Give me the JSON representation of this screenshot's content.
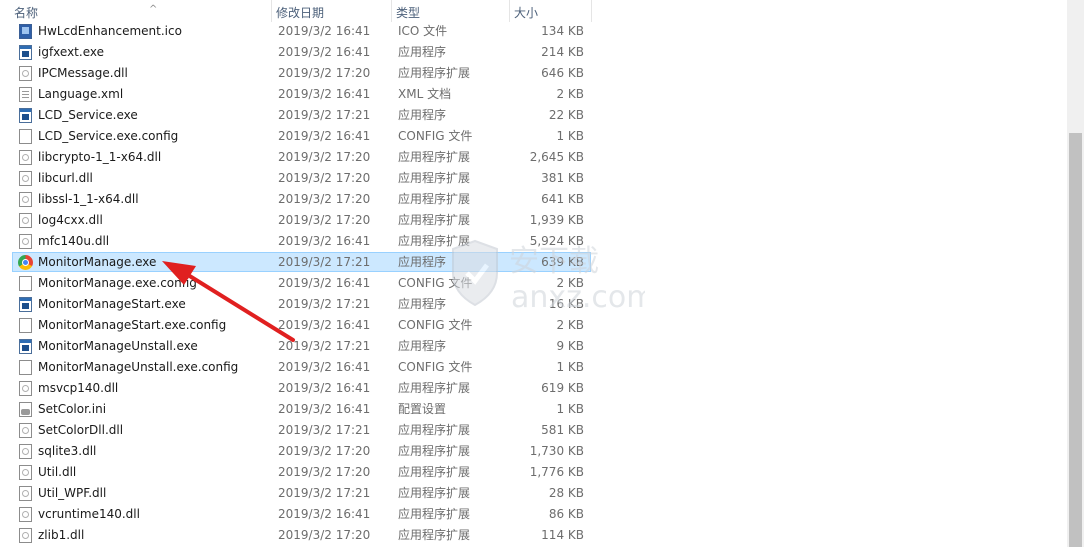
{
  "columns": {
    "name": "名称",
    "date": "修改日期",
    "type": "类型",
    "size": "大小"
  },
  "sort_indicator": "^",
  "files": [
    {
      "icon": "ico-file-icon",
      "name": "HwLcdEnhancement.ico",
      "date": "2019/3/2 16:41",
      "type": "ICO 文件",
      "size": "134 KB"
    },
    {
      "icon": "exe-file-icon",
      "name": "igfxext.exe",
      "date": "2019/3/2 16:41",
      "type": "应用程序",
      "size": "214 KB"
    },
    {
      "icon": "dll-file-icon",
      "name": "IPCMessage.dll",
      "date": "2019/3/2 17:20",
      "type": "应用程序扩展",
      "size": "646 KB"
    },
    {
      "icon": "xml-file-icon",
      "name": "Language.xml",
      "date": "2019/3/2 16:41",
      "type": "XML 文档",
      "size": "2 KB"
    },
    {
      "icon": "exe-file-icon",
      "name": "LCD_Service.exe",
      "date": "2019/3/2 17:21",
      "type": "应用程序",
      "size": "22 KB"
    },
    {
      "icon": "config-file-icon",
      "name": "LCD_Service.exe.config",
      "date": "2019/3/2 16:41",
      "type": "CONFIG 文件",
      "size": "1 KB"
    },
    {
      "icon": "dll-file-icon",
      "name": "libcrypto-1_1-x64.dll",
      "date": "2019/3/2 17:20",
      "type": "应用程序扩展",
      "size": "2,645 KB"
    },
    {
      "icon": "dll-file-icon",
      "name": "libcurl.dll",
      "date": "2019/3/2 17:20",
      "type": "应用程序扩展",
      "size": "381 KB"
    },
    {
      "icon": "dll-file-icon",
      "name": "libssl-1_1-x64.dll",
      "date": "2019/3/2 17:20",
      "type": "应用程序扩展",
      "size": "641 KB"
    },
    {
      "icon": "dll-file-icon",
      "name": "log4cxx.dll",
      "date": "2019/3/2 17:20",
      "type": "应用程序扩展",
      "size": "1,939 KB"
    },
    {
      "icon": "dll-file-icon",
      "name": "mfc140u.dll",
      "date": "2019/3/2 16:41",
      "type": "应用程序扩展",
      "size": "5,924 KB"
    },
    {
      "icon": "app-file-icon",
      "name": "MonitorManage.exe",
      "date": "2019/3/2 17:21",
      "type": "应用程序",
      "size": "639 KB",
      "selected": true
    },
    {
      "icon": "config-file-icon",
      "name": "MonitorManage.exe.config",
      "date": "2019/3/2 16:41",
      "type": "CONFIG 文件",
      "size": "2 KB"
    },
    {
      "icon": "exe-file-icon",
      "name": "MonitorManageStart.exe",
      "date": "2019/3/2 17:21",
      "type": "应用程序",
      "size": "16 KB"
    },
    {
      "icon": "config-file-icon",
      "name": "MonitorManageStart.exe.config",
      "date": "2019/3/2 16:41",
      "type": "CONFIG 文件",
      "size": "2 KB"
    },
    {
      "icon": "exe-file-icon",
      "name": "MonitorManageUnstall.exe",
      "date": "2019/3/2 17:21",
      "type": "应用程序",
      "size": "9 KB"
    },
    {
      "icon": "config-file-icon",
      "name": "MonitorManageUnstall.exe.config",
      "date": "2019/3/2 16:41",
      "type": "CONFIG 文件",
      "size": "1 KB"
    },
    {
      "icon": "dll-file-icon",
      "name": "msvcp140.dll",
      "date": "2019/3/2 16:41",
      "type": "应用程序扩展",
      "size": "619 KB"
    },
    {
      "icon": "ini-file-icon",
      "name": "SetColor.ini",
      "date": "2019/3/2 16:41",
      "type": "配置设置",
      "size": "1 KB"
    },
    {
      "icon": "dll-file-icon",
      "name": "SetColorDll.dll",
      "date": "2019/3/2 17:21",
      "type": "应用程序扩展",
      "size": "581 KB"
    },
    {
      "icon": "dll-file-icon",
      "name": "sqlite3.dll",
      "date": "2019/3/2 17:20",
      "type": "应用程序扩展",
      "size": "1,730 KB"
    },
    {
      "icon": "dll-file-icon",
      "name": "Util.dll",
      "date": "2019/3/2 17:20",
      "type": "应用程序扩展",
      "size": "1,776 KB"
    },
    {
      "icon": "dll-file-icon",
      "name": "Util_WPF.dll",
      "date": "2019/3/2 17:21",
      "type": "应用程序扩展",
      "size": "28 KB"
    },
    {
      "icon": "dll-file-icon",
      "name": "vcruntime140.dll",
      "date": "2019/3/2 16:41",
      "type": "应用程序扩展",
      "size": "86 KB"
    },
    {
      "icon": "dll-file-icon",
      "name": "zlib1.dll",
      "date": "2019/3/2 17:20",
      "type": "应用程序扩展",
      "size": "114 KB"
    }
  ],
  "watermark": {
    "brand": "安下载",
    "domain": "anxz.com"
  },
  "colors": {
    "selection_bg": "#cce8ff",
    "selection_border": "#99d1ff",
    "annotation_arrow": "#e02020",
    "header_text": "#4c607a"
  }
}
